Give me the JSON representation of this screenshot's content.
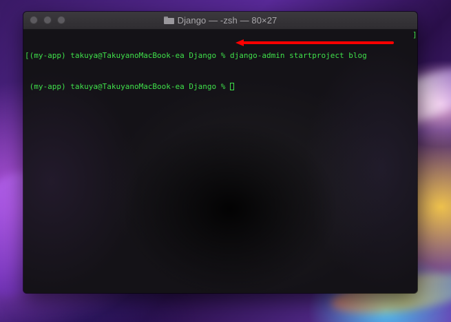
{
  "window": {
    "title": "Django — -zsh — 80×27"
  },
  "terminal": {
    "lines": [
      {
        "prefix": "[",
        "text": "(my-app) takuya@TakuyanoMacBook-ea Django % django-admin startproject blog",
        "suffix": "]"
      },
      {
        "prefix": " ",
        "text": "(my-app) takuya@TakuyanoMacBook-ea Django % "
      }
    ]
  },
  "colors": {
    "text": "#3fe04a",
    "annotation": "#ff0000"
  },
  "icons": {
    "folder": "folder-icon",
    "cursor": "block-cursor"
  }
}
